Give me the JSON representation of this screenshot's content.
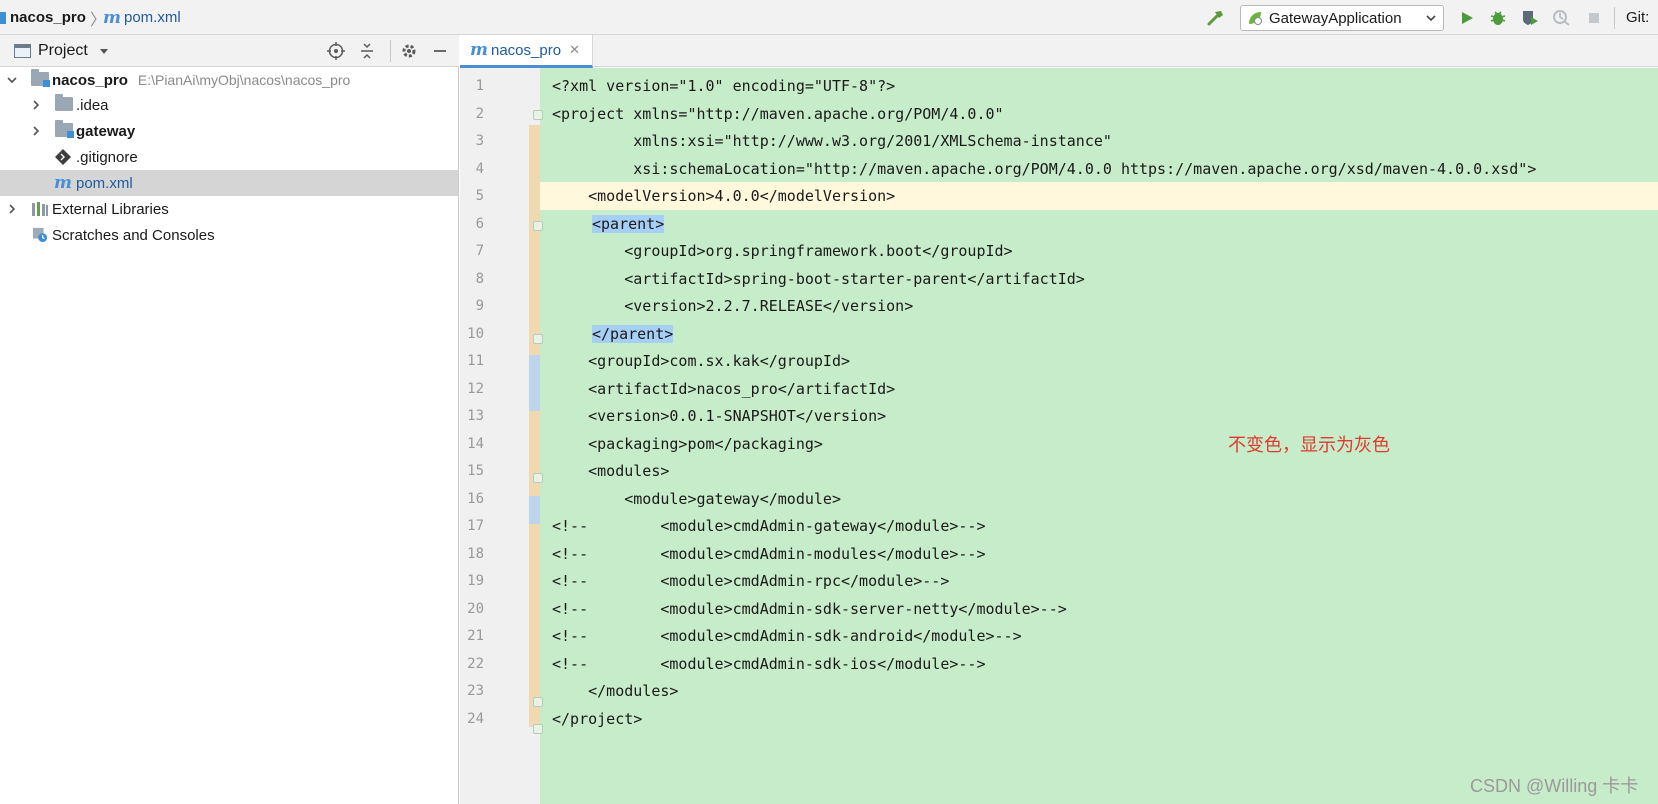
{
  "breadcrumb": {
    "project": "nacos_pro",
    "file": "pom.xml"
  },
  "toolbar": {
    "run_config": "GatewayApplication",
    "git_label": "Git:"
  },
  "project_panel": {
    "title": "Project",
    "tree": [
      {
        "label": "nacos_pro",
        "path": "E:\\PianAi\\myObj\\nacos\\nacos_pro",
        "icon": "module-folder-icon",
        "expanded": true
      },
      {
        "label": ".idea",
        "icon": "folder-icon",
        "expanded": false
      },
      {
        "label": "gateway",
        "icon": "module-folder-icon",
        "expanded": false
      },
      {
        "label": ".gitignore",
        "icon": "gitignore-icon"
      },
      {
        "label": "pom.xml",
        "icon": "maven-icon",
        "selected": true
      },
      {
        "label": "External Libraries",
        "icon": "libraries-icon",
        "expanded": false
      },
      {
        "label": "Scratches and Consoles",
        "icon": "scratches-icon"
      }
    ]
  },
  "editor": {
    "tab_label": "nacos_pro",
    "annotation": "不变色，显示为灰色",
    "watermark": "CSDN @Willing 卡卡",
    "lines": [
      {
        "n": "1",
        "text": "<?xml version=\"1.0\" encoding=\"UTF-8\"?>"
      },
      {
        "n": "2",
        "text": "<project xmlns=\"http://maven.apache.org/POM/4.0.0\""
      },
      {
        "n": "3",
        "text": "         xmlns:xsi=\"http://www.w3.org/2001/XMLSchema-instance\""
      },
      {
        "n": "4",
        "text": "         xsi:schemaLocation=\"http://maven.apache.org/POM/4.0.0 https://maven.apache.org/xsd/maven-4.0.0.xsd\">"
      },
      {
        "n": "5",
        "text": "    <modelVersion>4.0.0</modelVersion>"
      },
      {
        "n": "6",
        "text": "<parent>"
      },
      {
        "n": "7",
        "text": "        <groupId>org.springframework.boot</groupId>"
      },
      {
        "n": "8",
        "text": "        <artifactId>spring-boot-starter-parent</artifactId>"
      },
      {
        "n": "9",
        "text": "        <version>2.2.7.RELEASE</version>"
      },
      {
        "n": "10",
        "text": "</parent>"
      },
      {
        "n": "11",
        "text": "    <groupId>com.sx.kak</groupId>"
      },
      {
        "n": "12",
        "text": "    <artifactId>nacos_pro</artifactId>"
      },
      {
        "n": "13",
        "text": "    <version>0.0.1-SNAPSHOT</version>"
      },
      {
        "n": "14",
        "text": "    <packaging>pom</packaging>"
      },
      {
        "n": "15",
        "text": "    <modules>"
      },
      {
        "n": "16",
        "text": "        <module>gateway</module>"
      },
      {
        "n": "17",
        "text": "<!--        <module>cmdAdmin-gateway</module>-->"
      },
      {
        "n": "18",
        "text": "<!--        <module>cmdAdmin-modules</module>-->"
      },
      {
        "n": "19",
        "text": "<!--        <module>cmdAdmin-rpc</module>-->"
      },
      {
        "n": "20",
        "text": "<!--        <module>cmdAdmin-sdk-server-netty</module>-->"
      },
      {
        "n": "21",
        "text": "<!--        <module>cmdAdmin-sdk-android</module>-->"
      },
      {
        "n": "22",
        "text": "<!--        <module>cmdAdmin-sdk-ios</module>-->"
      },
      {
        "n": "23",
        "text": "    </modules>"
      },
      {
        "n": "24",
        "text": "</project>"
      }
    ]
  },
  "colors": {
    "changed_bg": "#c7ecc9",
    "caret_line": "#fff8dc",
    "tag_highlight": "#a6cff5",
    "annotation": "#e03a2f"
  }
}
